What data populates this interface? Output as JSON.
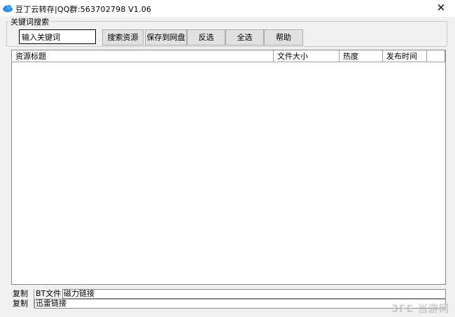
{
  "window": {
    "title": "豆丁云转存|QQ群:563702798  V1.06",
    "close_glyph": "✕",
    "icon": "cloud-icon"
  },
  "search_group": {
    "legend": "关键词搜索",
    "keyword_value": "输入关键词",
    "buttons": {
      "search": "搜索资源",
      "save": "保存到网盘",
      "invert": "反选",
      "select_all": "全选",
      "help": "帮助"
    }
  },
  "results_table": {
    "columns": [
      "资源标题",
      "文件大小",
      "热度",
      "发布时间"
    ],
    "rows": []
  },
  "bottom": {
    "row1": {
      "copy_label": "复制",
      "type_label": "BT文件",
      "link_label": "磁力链接"
    },
    "row2": {
      "copy_label": "复制",
      "link_label": "迅雷链接"
    }
  },
  "watermark": "3FE 当游网"
}
